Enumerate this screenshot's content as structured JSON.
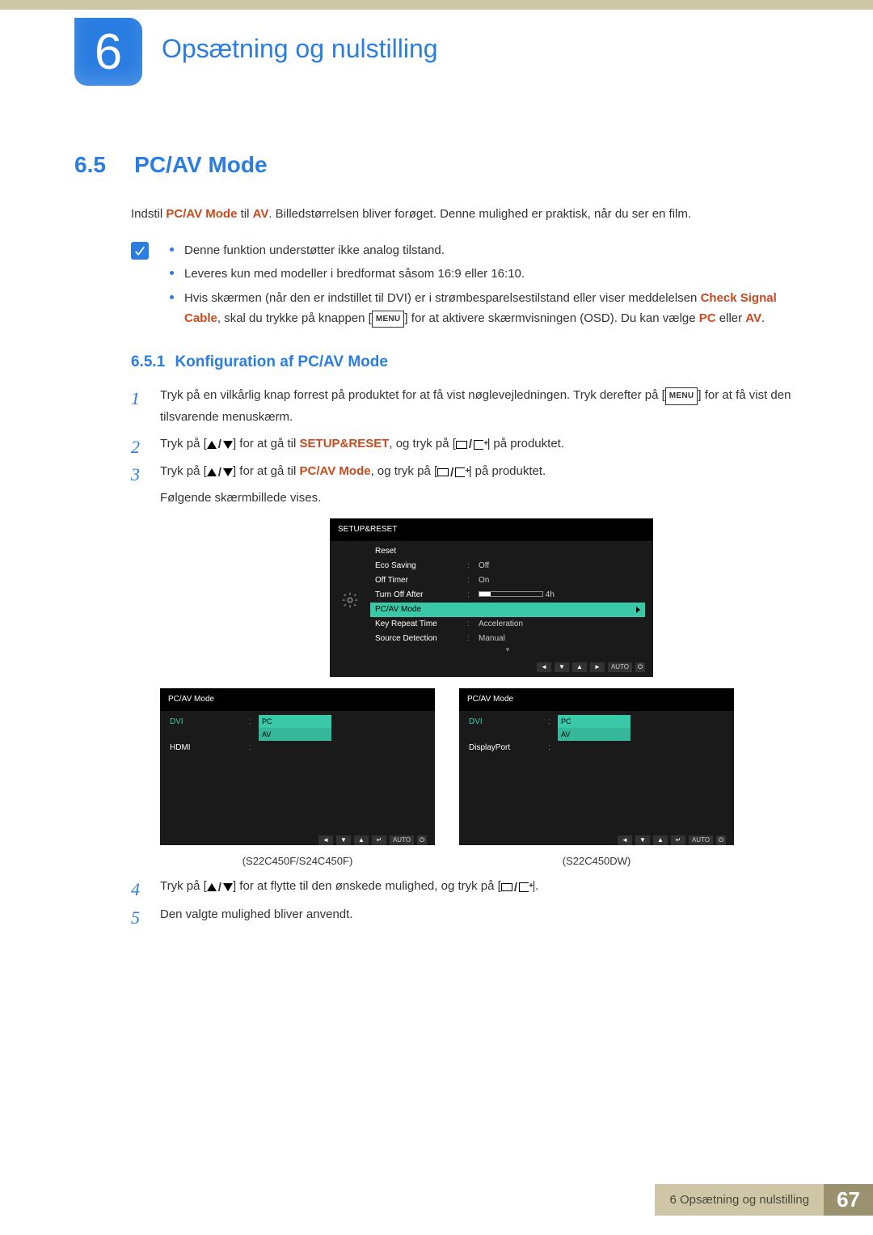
{
  "chapter": {
    "number": "6",
    "title": "Opsætning og nulstilling"
  },
  "section": {
    "number": "6.5",
    "title": "PC/AV Mode",
    "intro_pre": "Indstil ",
    "intro_accent1": "PC/AV Mode",
    "intro_mid": " til ",
    "intro_accent2": "AV",
    "intro_post": ". Billedstørrelsen bliver forøget. Denne mulighed er praktisk, når du ser en film."
  },
  "notes": {
    "n1": "Denne funktion understøtter ikke analog tilstand.",
    "n2": "Leveres kun med modeller i bredformat såsom 16:9 eller 16:10.",
    "n3_pre": "Hvis skærmen (når den er indstillet til DVI) er i strømbesparelsestilstand eller viser meddelelsen ",
    "n3_accent1": "Check Signal Cable",
    "n3_mid1": ", skal du trykke på knappen [",
    "n3_btn": "MENU",
    "n3_mid2": "] for at aktivere skærmvisningen (OSD). Du kan vælge ",
    "n3_accent2": "PC",
    "n3_or": " eller ",
    "n3_accent3": "AV",
    "n3_end": "."
  },
  "subsection": {
    "number": "6.5.1",
    "title": "Konfiguration af PC/AV Mode"
  },
  "steps": {
    "s1_pre": "Tryk på en vilkårlig knap forrest på produktet for at få vist nøglevejledningen. Tryk derefter på [",
    "s1_btn": "MENU",
    "s1_post": "] for at få vist den tilsvarende menuskærm.",
    "s2_pre": "Tryk på [",
    "s2_mid1": "] for at gå til ",
    "s2_accent": "SETUP&RESET",
    "s2_mid2": ", og tryk på [",
    "s2_post": "] på produktet.",
    "s3_pre": "Tryk på [",
    "s3_mid1": "] for at gå til ",
    "s3_accent": "PC/AV Mode",
    "s3_mid2": ", og tryk på [",
    "s3_post": "] på produktet.",
    "s3_after": "Følgende skærmbillede vises.",
    "s4_pre": "Tryk på [",
    "s4_mid": "] for at flytte til den ønskede mulighed, og tryk på [",
    "s4_post": "].",
    "s5": "Den valgte mulighed bliver anvendt."
  },
  "osd_main": {
    "title": "SETUP&RESET",
    "rows": {
      "reset": "Reset",
      "eco": "Eco Saving",
      "eco_v": "Off",
      "timer": "Off Timer",
      "timer_v": "On",
      "turnoff": "Turn Off After",
      "turnoff_v": "4h",
      "pcav": "PC/AV Mode",
      "key": "Key Repeat Time",
      "key_v": "Acceleration",
      "src": "Source Detection",
      "src_v": "Manual"
    },
    "nav_auto": "AUTO"
  },
  "osd_left": {
    "title": "PC/AV Mode",
    "row1": "DVI",
    "row1_v1": "PC",
    "row1_v2": "AV",
    "row2": "HDMI",
    "caption": "(S22C450F/S24C450F)",
    "nav_auto": "AUTO"
  },
  "osd_right": {
    "title": "PC/AV Mode",
    "row1": "DVI",
    "row1_v1": "PC",
    "row1_v2": "AV",
    "row2": "DisplayPort",
    "caption": "(S22C450DW)",
    "nav_auto": "AUTO"
  },
  "footer": {
    "label": "6 Opsætning og nulstilling",
    "page": "67"
  }
}
